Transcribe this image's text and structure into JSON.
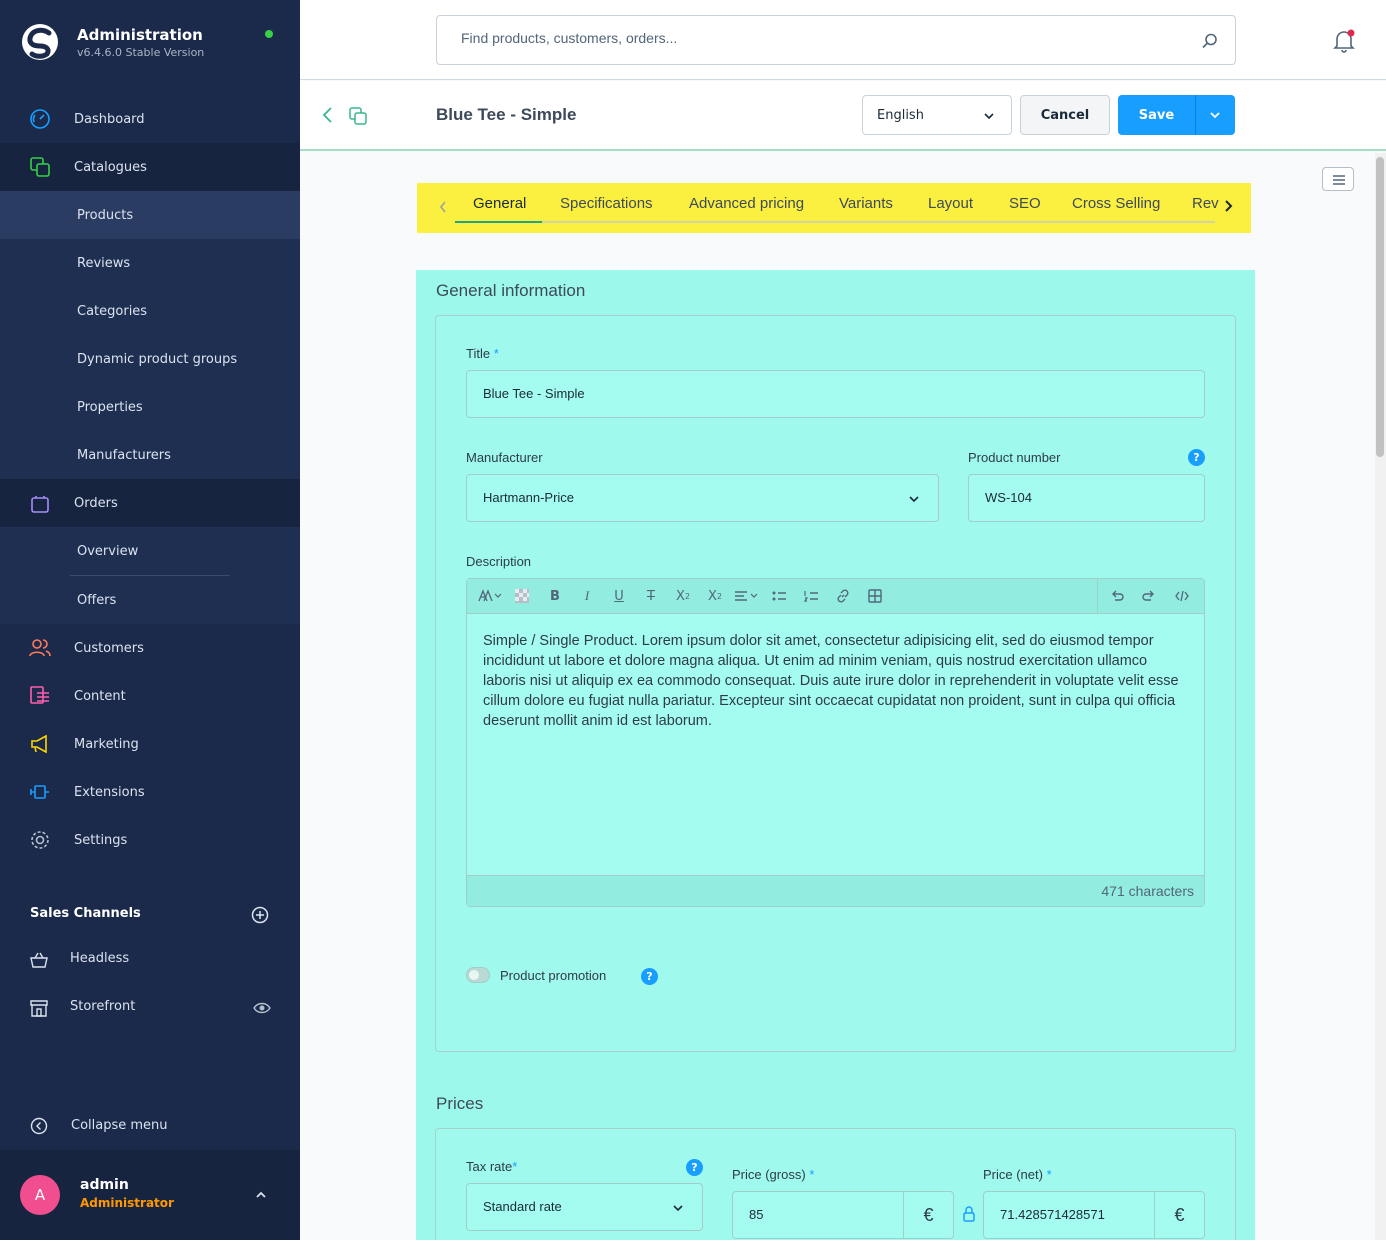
{
  "app": {
    "title": "Administration",
    "version": "v6.4.6.0 Stable Version"
  },
  "colors": {
    "sidebar": "#1b2a4a",
    "primary": "#189eff",
    "status_online": "#37d046",
    "role": "#ff9800",
    "avatar": "#f14e8f",
    "tabs_highlight": "#fbef3f",
    "content_highlight": "#9df8ec"
  },
  "nav": {
    "dashboard": "Dashboard",
    "catalogues": "Catalogues",
    "catalogue_items": [
      "Products",
      "Reviews",
      "Categories",
      "Dynamic product groups",
      "Properties",
      "Manufacturers"
    ],
    "orders": "Orders",
    "order_items": [
      "Overview",
      "Offers"
    ],
    "customers": "Customers",
    "content": "Content",
    "marketing": "Marketing",
    "extensions": "Extensions",
    "settings": "Settings"
  },
  "sales_channels": {
    "title": "Sales Channels",
    "items": [
      "Headless",
      "Storefront"
    ]
  },
  "collapse_label": "Collapse menu",
  "user": {
    "name": "admin",
    "role": "Administrator",
    "initial": "A"
  },
  "search": {
    "placeholder": "Find products, customers, orders..."
  },
  "smartbar": {
    "title": "Blue Tee - Simple",
    "language": "English",
    "cancel": "Cancel",
    "save": "Save"
  },
  "tabs": [
    "General",
    "Specifications",
    "Advanced pricing",
    "Variants",
    "Layout",
    "SEO",
    "Cross Selling",
    "Rev"
  ],
  "active_tab": "General",
  "general": {
    "heading": "General information",
    "title_label": "Title",
    "title_value": "Blue Tee - Simple",
    "manufacturer_label": "Manufacturer",
    "manufacturer_value": "Hartmann-Price",
    "product_number_label": "Product number",
    "product_number_value": "WS-104",
    "description_label": "Description",
    "description_text": "Simple / Single Product. Lorem ipsum dolor sit amet, consectetur adipisicing elit, sed do eiusmod tempor incididunt ut labore et dolore magna aliqua. Ut enim ad minim veniam, quis nostrud exercitation ullamco laboris nisi ut aliquip ex ea commodo consequat. Duis aute irure dolor in reprehenderit in voluptate velit esse cillum dolore eu fugiat nulla pariatur. Excepteur sint occaecat cupidatat non proident, sunt in culpa qui officia deserunt mollit anim id est laborum.",
    "char_count": "471 characters",
    "promotion_label": "Product promotion",
    "help": "?"
  },
  "prices": {
    "heading": "Prices",
    "tax_label": "Tax rate",
    "tax_value": "Standard rate",
    "gross_label": "Price (gross)",
    "gross_value": "85",
    "net_label": "Price (net)",
    "net_value": "71.428571428571",
    "currency": "€",
    "required_mark": "*"
  }
}
